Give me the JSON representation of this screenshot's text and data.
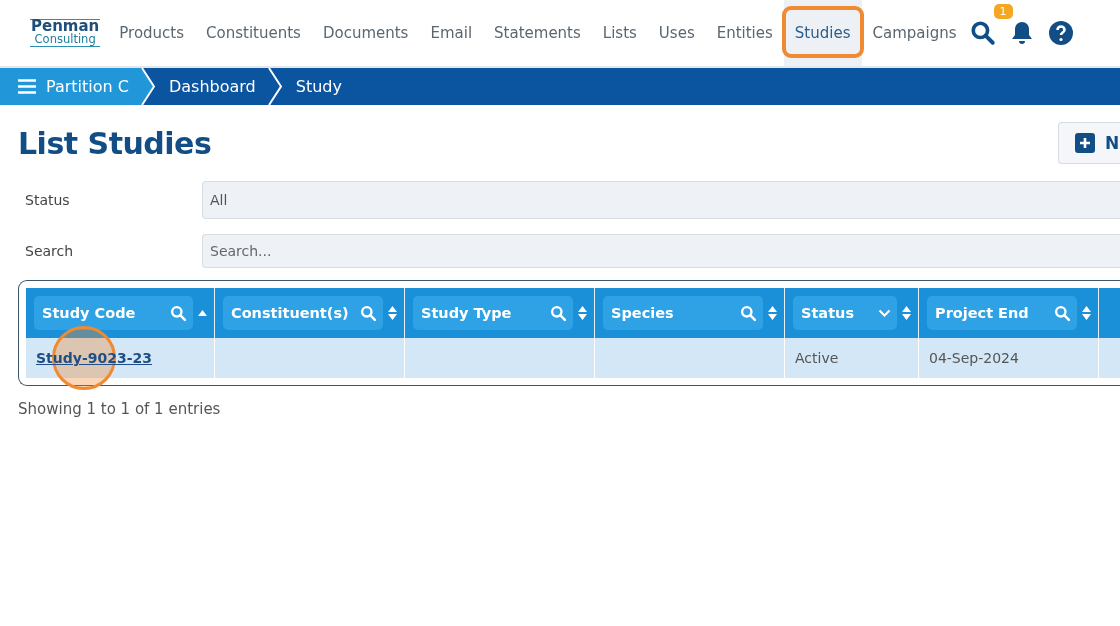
{
  "logo": {
    "line_1": "Penman",
    "line_2": "Consulting"
  },
  "nav": [
    {
      "label": "Products",
      "selected": false,
      "highlighted": false
    },
    {
      "label": "Constituents",
      "selected": false,
      "highlighted": false
    },
    {
      "label": "Documents",
      "selected": false,
      "highlighted": false
    },
    {
      "label": "Email",
      "selected": false,
      "highlighted": false
    },
    {
      "label": "Statements",
      "selected": false,
      "highlighted": false
    },
    {
      "label": "Lists",
      "selected": false,
      "highlighted": false
    },
    {
      "label": "Uses",
      "selected": false,
      "highlighted": false
    },
    {
      "label": "Entities",
      "selected": false,
      "highlighted": false
    },
    {
      "label": "Studies",
      "selected": true,
      "highlighted": true
    },
    {
      "label": "Campaigns",
      "selected": false,
      "highlighted": false
    }
  ],
  "notification_count": "1",
  "breadcrumbs": [
    {
      "label": "Partition C",
      "kind": "menu"
    },
    {
      "label": "Dashboard",
      "kind": "crumb"
    },
    {
      "label": "Study",
      "kind": "crumb"
    }
  ],
  "title": "List Studies",
  "new_button": "N",
  "filters": [
    {
      "label": "Status",
      "value": "All"
    },
    {
      "label": "Search",
      "placeholder": "Search..."
    }
  ],
  "table": {
    "columns": [
      {
        "label": "Study Code",
        "kind": "search",
        "sorted": true
      },
      {
        "label": "Constituent(s)",
        "kind": "search",
        "sorted": false
      },
      {
        "label": "Study Type",
        "kind": "search",
        "sorted": false
      },
      {
        "label": "Species",
        "kind": "search",
        "sorted": false
      },
      {
        "label": "Status",
        "kind": "dropdown",
        "sorted": false
      },
      {
        "label": "Project End",
        "kind": "search",
        "sorted": false
      }
    ],
    "rows": [
      {
        "study_code": "Study-9023-23",
        "clicked": true,
        "status": "Active",
        "project_end": "04-Sep-2024"
      }
    ]
  },
  "footer": "Showing 1 to 1 of 1 entries"
}
